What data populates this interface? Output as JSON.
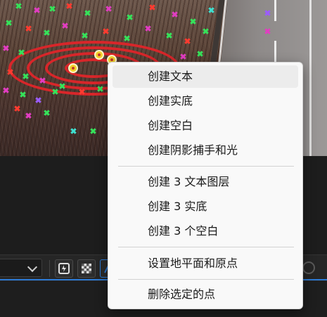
{
  "menu": {
    "items": [
      {
        "label": "创建文本",
        "highlighted": true
      },
      {
        "label": "创建实底"
      },
      {
        "label": "创建空白"
      },
      {
        "label": "创建阴影捕手和光"
      },
      {
        "label": "创建 3 文本图层"
      },
      {
        "label": "创建 3 实底"
      },
      {
        "label": "创建 3 个空白"
      },
      {
        "label": "设置地平面和原点"
      },
      {
        "label": "删除选定的点"
      }
    ]
  },
  "colors": {
    "target_ring": "#d8262a",
    "track_point_green": "#36e25a",
    "track_point_magenta": "#e23dc2",
    "track_point_red": "#ff3b30",
    "accent_blue": "#2d7bd6",
    "menu_background": "#f9f9f9"
  },
  "icons": {
    "toolbar": [
      "dropdown-chevron-icon",
      "snapshot-icon",
      "transparency-grid-icon",
      "3d-track-icon",
      "settings-icon"
    ],
    "viewport": [
      "target-ring-icon",
      "track-point-icon"
    ]
  }
}
